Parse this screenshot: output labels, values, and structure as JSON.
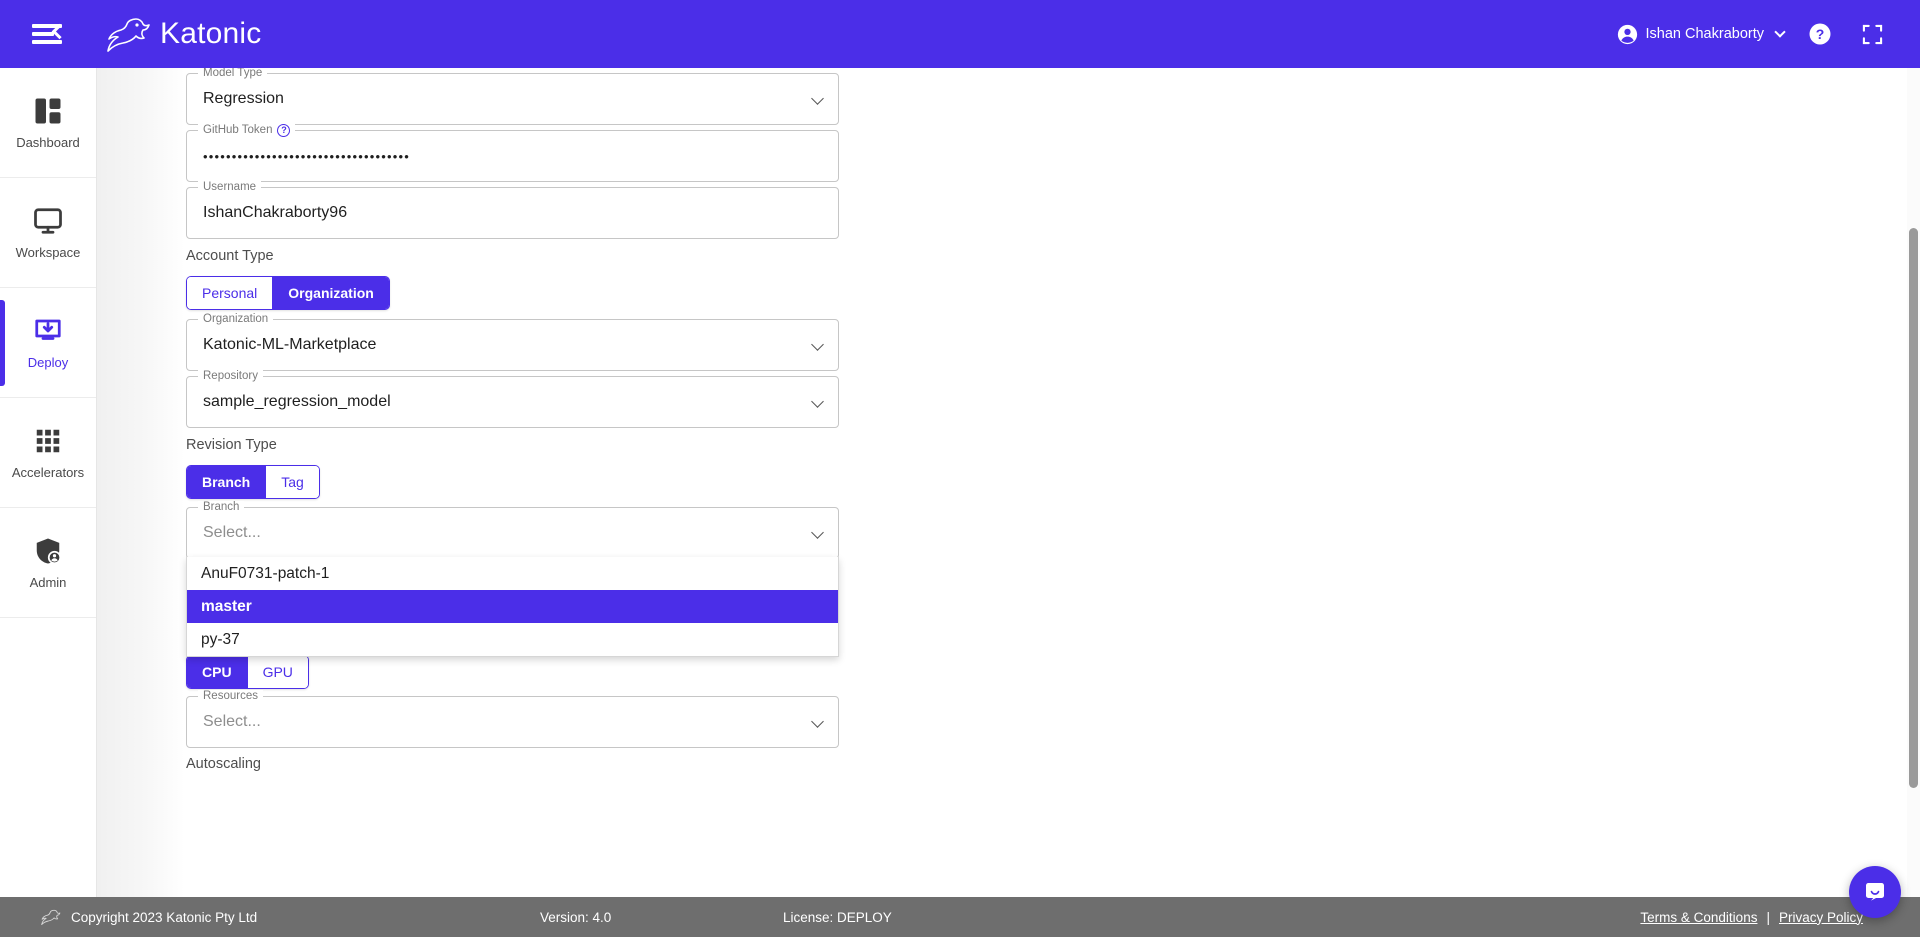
{
  "header": {
    "menu_icon": "hamburger-collapse-icon",
    "brand": "Katonic",
    "user_name": "Ishan Chakraborty",
    "help_icon": "help-circle-icon",
    "fullscreen_icon": "fullscreen-icon",
    "brand_color": "#4b2ee8"
  },
  "sidebar": {
    "items": [
      {
        "label": "Dashboard",
        "icon": "dashboard-icon",
        "active": false
      },
      {
        "label": "Workspace",
        "icon": "monitor-icon",
        "active": false
      },
      {
        "label": "Deploy",
        "icon": "deploy-icon",
        "active": true
      },
      {
        "label": "Accelerators",
        "icon": "grid-apps-icon",
        "active": false
      },
      {
        "label": "Admin",
        "icon": "admin-user-icon",
        "active": false
      }
    ],
    "active_color": "#4b2ee8"
  },
  "form": {
    "model_type": {
      "label": "Model Type",
      "value": "Regression"
    },
    "github_token": {
      "label": "GitHub Token",
      "value": "••••••••••••••••••••••••••••••••••••",
      "help_icon": "question-mark-icon"
    },
    "username": {
      "label": "Username",
      "value": "IshanChakraborty96"
    },
    "account_type": {
      "label": "Account Type",
      "options": [
        "Personal",
        "Organization"
      ],
      "selected": "Organization"
    },
    "organization": {
      "label": "Organization",
      "value": "Katonic-ML-Marketplace"
    },
    "repository": {
      "label": "Repository",
      "value": "sample_regression_model"
    },
    "revision_type": {
      "label": "Revision Type",
      "options": [
        "Branch",
        "Tag"
      ],
      "selected": "Branch"
    },
    "branch": {
      "label": "Branch",
      "placeholder": "Select...",
      "value": "",
      "open": true,
      "options": [
        "AnuF0731-patch-1",
        "master",
        "py-37"
      ],
      "highlighted": "master"
    },
    "compute_type": {
      "options": [
        "CPU",
        "GPU"
      ],
      "selected": "CPU"
    },
    "resources": {
      "label": "Resources",
      "placeholder": "Select..."
    },
    "autoscaling_label": "Autoscaling"
  },
  "footer": {
    "copyright": "Copyright 2023 Katonic Pty Ltd",
    "version": "Version: 4.0",
    "license": "License: DEPLOY",
    "terms": "Terms & Conditions",
    "separator": "|",
    "privacy": "Privacy Policy",
    "logo_icon": "kangaroo-logo-icon"
  },
  "chat": {
    "icon": "chat-bubble-icon"
  }
}
